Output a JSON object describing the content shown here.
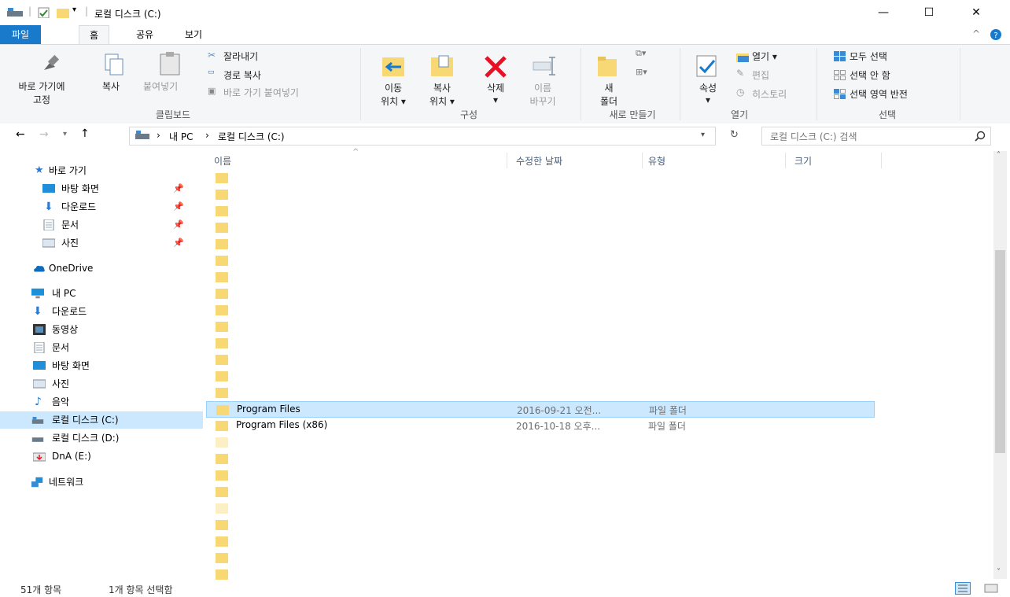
{
  "window": {
    "title": "로컬 디스크 (C:)",
    "minimize": "—",
    "maximize": "☐",
    "close": "✕"
  },
  "ribbon_tabs": [
    {
      "label": "파일"
    },
    {
      "label": "홈"
    },
    {
      "label": "공유"
    },
    {
      "label": "보기"
    }
  ],
  "ribbon": {
    "clipboard": {
      "pin_quick": "바로 가기에",
      "pin_quick2": "고정",
      "copy": "복사",
      "paste": "붙여넣기",
      "cut": "잘라내기",
      "copy_path": "경로 복사",
      "paste_shortcut": "바로 가기 붙여넣기",
      "group": "클립보드"
    },
    "organize": {
      "move_to": "이동",
      "move_to2": "위치 ▾",
      "copy_to": "복사",
      "copy_to2": "위치 ▾",
      "delete": "삭제",
      "delete2": "▾",
      "rename": "이름",
      "rename2": "바꾸기",
      "group": "구성"
    },
    "new": {
      "new_folder": "새",
      "new_folder2": "폴더",
      "group": "새로 만들기"
    },
    "open": {
      "properties": "속성",
      "properties2": "▾",
      "open": "열기 ▾",
      "edit": "편집",
      "history": "히스토리",
      "group": "열기"
    },
    "select": {
      "select_all": "모두 선택",
      "select_none": "선택 안 함",
      "invert": "선택 영역 반전",
      "group": "선택"
    }
  },
  "address": {
    "path": [
      "내 PC",
      "로컬 디스크 (C:)"
    ],
    "separator": "›",
    "search_placeholder": "로컬 디스크 (C:) 검색"
  },
  "nav": {
    "quick_access": "바로 가기",
    "items": [
      {
        "label": "바탕 화면",
        "pinned": "📌",
        "icon": "desktop-icon"
      },
      {
        "label": "다운로드",
        "pinned": "📌",
        "icon": "download-icon"
      },
      {
        "label": "문서",
        "pinned": "📌",
        "icon": "documents-icon"
      },
      {
        "label": "사진",
        "pinned": "📌",
        "icon": "pictures-icon"
      }
    ],
    "onedrive": "OneDrive",
    "this_pc": "내 PC",
    "pc_items": [
      {
        "label": "다운로드",
        "icon": "download-icon"
      },
      {
        "label": "동영상",
        "icon": "videos-icon"
      },
      {
        "label": "문서",
        "icon": "documents-icon"
      },
      {
        "label": "바탕 화면",
        "icon": "desktop-icon"
      },
      {
        "label": "사진",
        "icon": "pictures-icon"
      },
      {
        "label": "음악",
        "icon": "music-icon"
      },
      {
        "label": "로컬 디스크 (C:)",
        "icon": "drive-icon",
        "selected": true
      },
      {
        "label": "로컬 디스크 (D:)",
        "icon": "drive-icon"
      },
      {
        "label": "DnA (E:)",
        "icon": "usb-drive-icon"
      }
    ],
    "network": "네트워크"
  },
  "columns": {
    "name": "이름",
    "date": "수정한 날짜",
    "type": "유형",
    "size": "크기"
  },
  "rows": [
    {
      "name": "",
      "date": "",
      "type": ""
    },
    {
      "name": "",
      "date": "",
      "type": ""
    },
    {
      "name": "",
      "date": "",
      "type": ""
    },
    {
      "name": "",
      "date": "",
      "type": ""
    },
    {
      "name": "",
      "date": "",
      "type": ""
    },
    {
      "name": "",
      "date": "",
      "type": ""
    },
    {
      "name": "",
      "date": "",
      "type": ""
    },
    {
      "name": "",
      "date": "",
      "type": ""
    },
    {
      "name": "",
      "date": "",
      "type": ""
    },
    {
      "name": "",
      "date": "",
      "type": ""
    },
    {
      "name": "",
      "date": "",
      "type": ""
    },
    {
      "name": "",
      "date": "",
      "type": ""
    },
    {
      "name": "",
      "date": "",
      "type": ""
    },
    {
      "name": "",
      "date": "",
      "type": ""
    },
    {
      "name": "Program Files",
      "date": "2016-09-21 오전...",
      "type": "파일 폴더",
      "selected": true
    },
    {
      "name": "Program Files (x86)",
      "date": "2016-10-18 오후...",
      "type": "파일 폴더"
    },
    {
      "name": "",
      "date": "",
      "type": "",
      "faded": true
    },
    {
      "name": "",
      "date": "",
      "type": ""
    },
    {
      "name": "",
      "date": "",
      "type": ""
    },
    {
      "name": "",
      "date": "",
      "type": ""
    },
    {
      "name": "",
      "date": "",
      "type": "",
      "faded": true
    },
    {
      "name": "",
      "date": "",
      "type": ""
    },
    {
      "name": "",
      "date": "",
      "type": ""
    },
    {
      "name": "",
      "date": "",
      "type": ""
    },
    {
      "name": "",
      "date": "",
      "type": ""
    }
  ],
  "status": {
    "count": "51개 항목",
    "selected": "1개 항목 선택함"
  },
  "colors": {
    "accent": "#1979ca",
    "selection": "#cce8ff",
    "folder": "#f8d775",
    "delete": "#e81123"
  }
}
